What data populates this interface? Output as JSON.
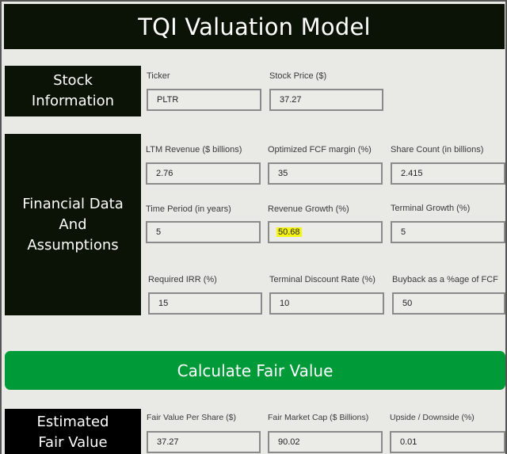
{
  "header": {
    "title": "TQI Valuation Model"
  },
  "sections": {
    "stock_info": {
      "label_line1": "Stock",
      "label_line2": "Information",
      "fields": [
        {
          "label": "Ticker",
          "value": "PLTR"
        },
        {
          "label": "Stock Price ($)",
          "value": "37.27"
        }
      ]
    },
    "financial": {
      "label_line1": "Financial Data",
      "label_line2": "And",
      "label_line3": "Assumptions",
      "fields": [
        {
          "label": "LTM Revenue ($ billions)",
          "value": "2.76"
        },
        {
          "label": "Optimized FCF margin (%)",
          "value": "35"
        },
        {
          "label": "Share Count (in billions)",
          "value": "2.415"
        },
        {
          "label": "Time Period (in years)",
          "value": "5"
        },
        {
          "label": "Revenue Growth (%)",
          "value": "50.68",
          "highlighted": true
        },
        {
          "label": "Terminal Growth (%)",
          "value": "5"
        },
        {
          "label": "Required IRR (%)",
          "value": "15"
        },
        {
          "label": "Terminal Discount Rate (%)",
          "value": "10"
        },
        {
          "label": "Buyback as a %age of FCF",
          "value": "50"
        }
      ]
    },
    "result": {
      "label_line1": "Estimated",
      "label_line2": "Fair Value",
      "fields": [
        {
          "label": "Fair Value Per Share ($)",
          "value": "37.27"
        },
        {
          "label": "Fair Market Cap ($ Billions)",
          "value": "90.02"
        },
        {
          "label": "Upside / Downside (%)",
          "value": "0.01"
        }
      ]
    }
  },
  "calculate_button": {
    "label": "Calculate Fair Value"
  },
  "colors": {
    "header_bg": "#0b1306",
    "button_green": "#009a38",
    "page_bg": "#e9eae6",
    "highlight": "#f5f512"
  }
}
